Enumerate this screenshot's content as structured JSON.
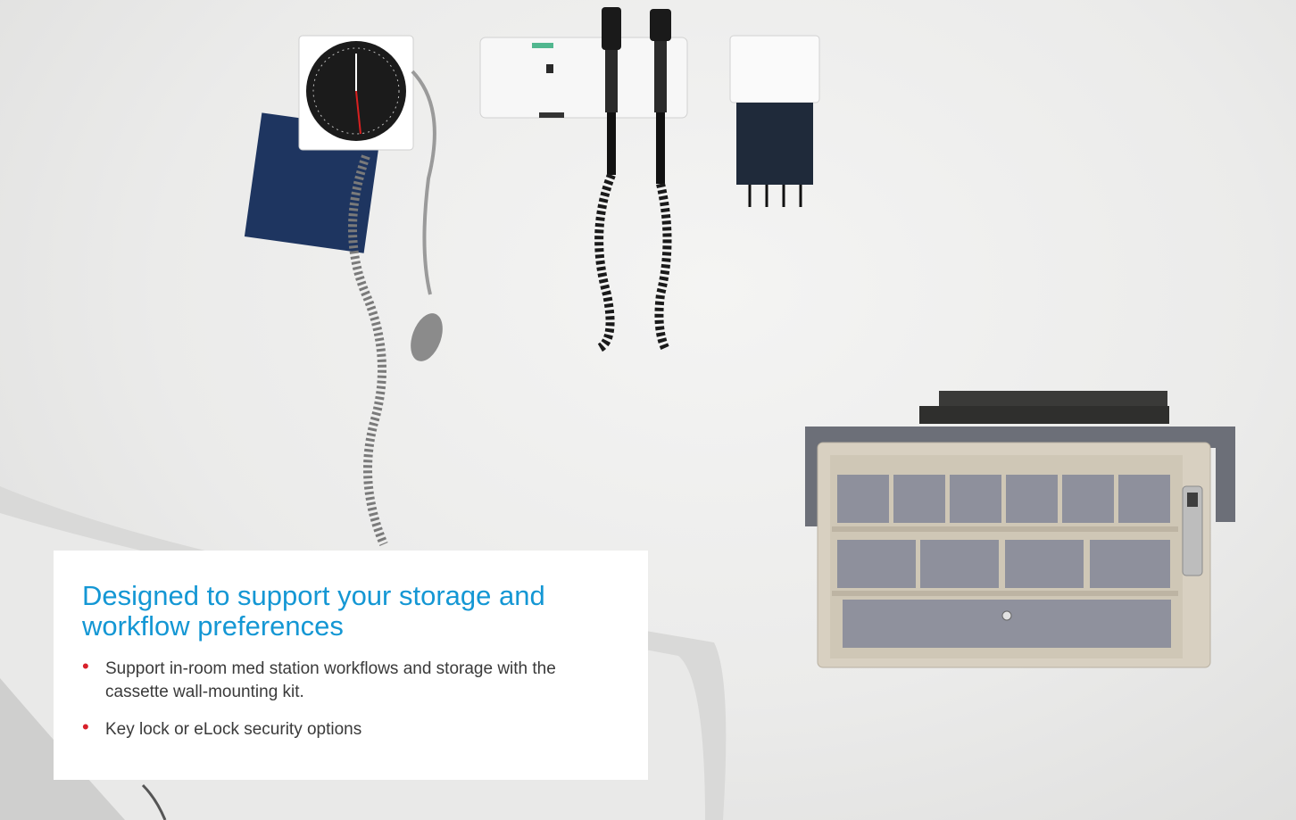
{
  "card": {
    "heading": "Designed to support your storage and workflow preferences",
    "bullets": [
      "Support in-room med station workflows and storage with the cassette wall-mounting kit.",
      "Key lock or eLock security options"
    ],
    "bullet_glyph": "•"
  },
  "colors": {
    "heading": "#1497d4",
    "bullet": "#d8202a",
    "body_text": "#3a3a3a",
    "wall": "#ebebea"
  },
  "icons": [
    "blood-pressure-gauge-icon",
    "otoscope-icon",
    "ophthalmoscope-icon",
    "specula-dispenser-icon",
    "wall-cassette-icon"
  ]
}
